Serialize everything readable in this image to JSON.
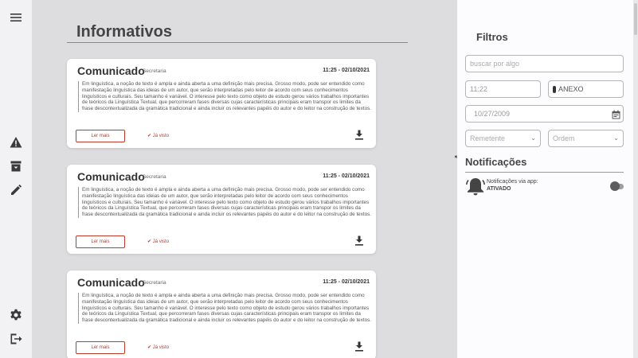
{
  "sidebar": {
    "icons": [
      "menu-icon",
      "warning-icon",
      "archive-icon",
      "pencil-icon",
      "gear-icon",
      "logout-icon"
    ]
  },
  "main": {
    "title": "Informativos",
    "cards": [
      {
        "title": "Comunicado",
        "department": "- Secretaria",
        "datetime": "11:25 - 02/10/2021",
        "body": "Em linguística, a noção de texto é ampla e ainda aberta a uma definição mais precisa. Grosso modo, pode ser entendido como manifestação linguística das ideias de um autor, que serão interpretadas pelo leitor de acordo com seus conhecimentos linguísticos e culturais. Seu tamanho é variável. O interesse pelo texto como objeto de estudo gerou vários trabalhos importantes de teóricos da Linguística Textual, que percorreram fases diversas cujas características principais eram transpor os limites da frase descontextualizada da gramática tradicional e ainda incluir os relevantes papéis do autor e do leitor na construção de textos.",
        "read_more": "Ler mais",
        "seen": "✔ Já visto"
      },
      {
        "title": "Comunicado",
        "department": "- Secretaria",
        "datetime": "11:25 - 02/10/2021",
        "body": "Em linguística, a noção de texto é ampla e ainda aberta a uma definição mais precisa. Grosso modo, pode ser entendido como manifestação linguística das ideias de um autor, que serão interpretadas pelo leitor de acordo com seus conhecimentos linguísticos e culturais. Seu tamanho é variável. O interesse pelo texto como objeto de estudo gerou vários trabalhos importantes de teóricos da Linguística Textual, que percorreram fases diversas cujas características principais eram transpor os limites da frase descontextualizada da gramática tradicional e ainda incluir os relevantes papéis do autor e do leitor na construção de textos.",
        "read_more": "Ler mais",
        "seen": "✔ Já visto"
      },
      {
        "title": "Comunicado",
        "department": "- Secretaria",
        "datetime": "11:25 - 02/10/2021",
        "body": "Em linguística, a noção de texto é ampla e ainda aberta a uma definição mais precisa. Grosso modo, pode ser entendido como manifestação linguística das ideias de um autor, que serão interpretadas pelo leitor de acordo com seus conhecimentos linguísticos e culturais. Seu tamanho é variável. O interesse pelo texto como objeto de estudo gerou vários trabalhos importantes de teóricos da Linguística Textual, que percorreram fases diversas cujas características principais eram transpor os limites da frase descontextualizada da gramática tradicional e ainda incluir os relevantes papéis do autor e do leitor na construção de textos.",
        "read_more": "Ler mais",
        "seen": "✔ Já visto"
      }
    ]
  },
  "filters": {
    "title": "Filtros",
    "search_placeholder": "buscar por algo",
    "time_value": "11:22",
    "attachment_label": "ANEXO",
    "date_value": "10/27/2009",
    "sender_placeholder": "Remetente",
    "order_placeholder": "Ordem"
  },
  "notifications": {
    "title": "Notificações",
    "label": "Notificações via app:",
    "status": "ATIVADO"
  },
  "colors": {
    "accent": "#c0392b",
    "background": "#dddcde",
    "card": "#ffffff"
  }
}
